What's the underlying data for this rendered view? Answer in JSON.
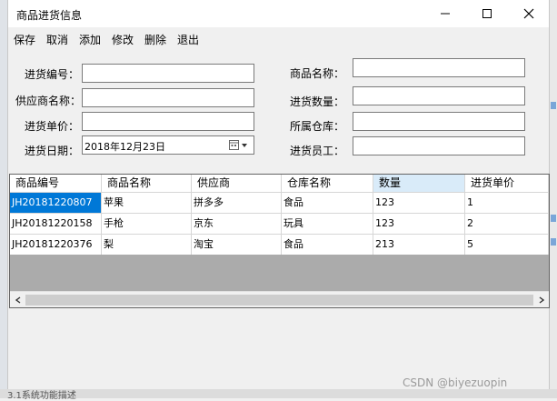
{
  "window": {
    "title": "商品进货信息"
  },
  "menu": [
    {
      "label": "保存"
    },
    {
      "label": "取消"
    },
    {
      "label": "添加"
    },
    {
      "label": "修改"
    },
    {
      "label": "删除"
    },
    {
      "label": "退出"
    }
  ],
  "form": {
    "purchase_no_label": "进货编号：",
    "product_name_label": "商品名称：",
    "supplier_label": "供应商名称：",
    "quantity_label": "进货数量：",
    "unit_price_label": "进货单价：",
    "warehouse_label": "所属仓库：",
    "date_label": "进货日期：",
    "date_value": "2018年12月23日",
    "staff_label": "进货员工："
  },
  "grid": {
    "columns": [
      "商品编号",
      "商品名称",
      "供应商",
      "仓库名称",
      "数量",
      "进货单价"
    ],
    "rows": [
      [
        "JH20181220807",
        "苹果",
        "拼多多",
        "食品",
        "123",
        "1"
      ],
      [
        "JH20181220158",
        "手枪",
        "京东",
        "玩具",
        "123",
        "2"
      ],
      [
        "JH20181220376",
        "梨",
        "淘宝",
        "食品",
        "213",
        "5"
      ]
    ]
  },
  "watermark": "CSDN @biyezuopin",
  "background_text": "3.1系统功能描述",
  "colors": {
    "selection": "#0078d7",
    "header_hover": "#d9ebf9",
    "grid_empty": "#ababab"
  },
  "icons": [
    "minimize-icon",
    "maximize-icon",
    "close-icon",
    "calendar-icon",
    "dropdown-arrow-icon",
    "scroll-left-icon",
    "scroll-right-icon"
  ]
}
